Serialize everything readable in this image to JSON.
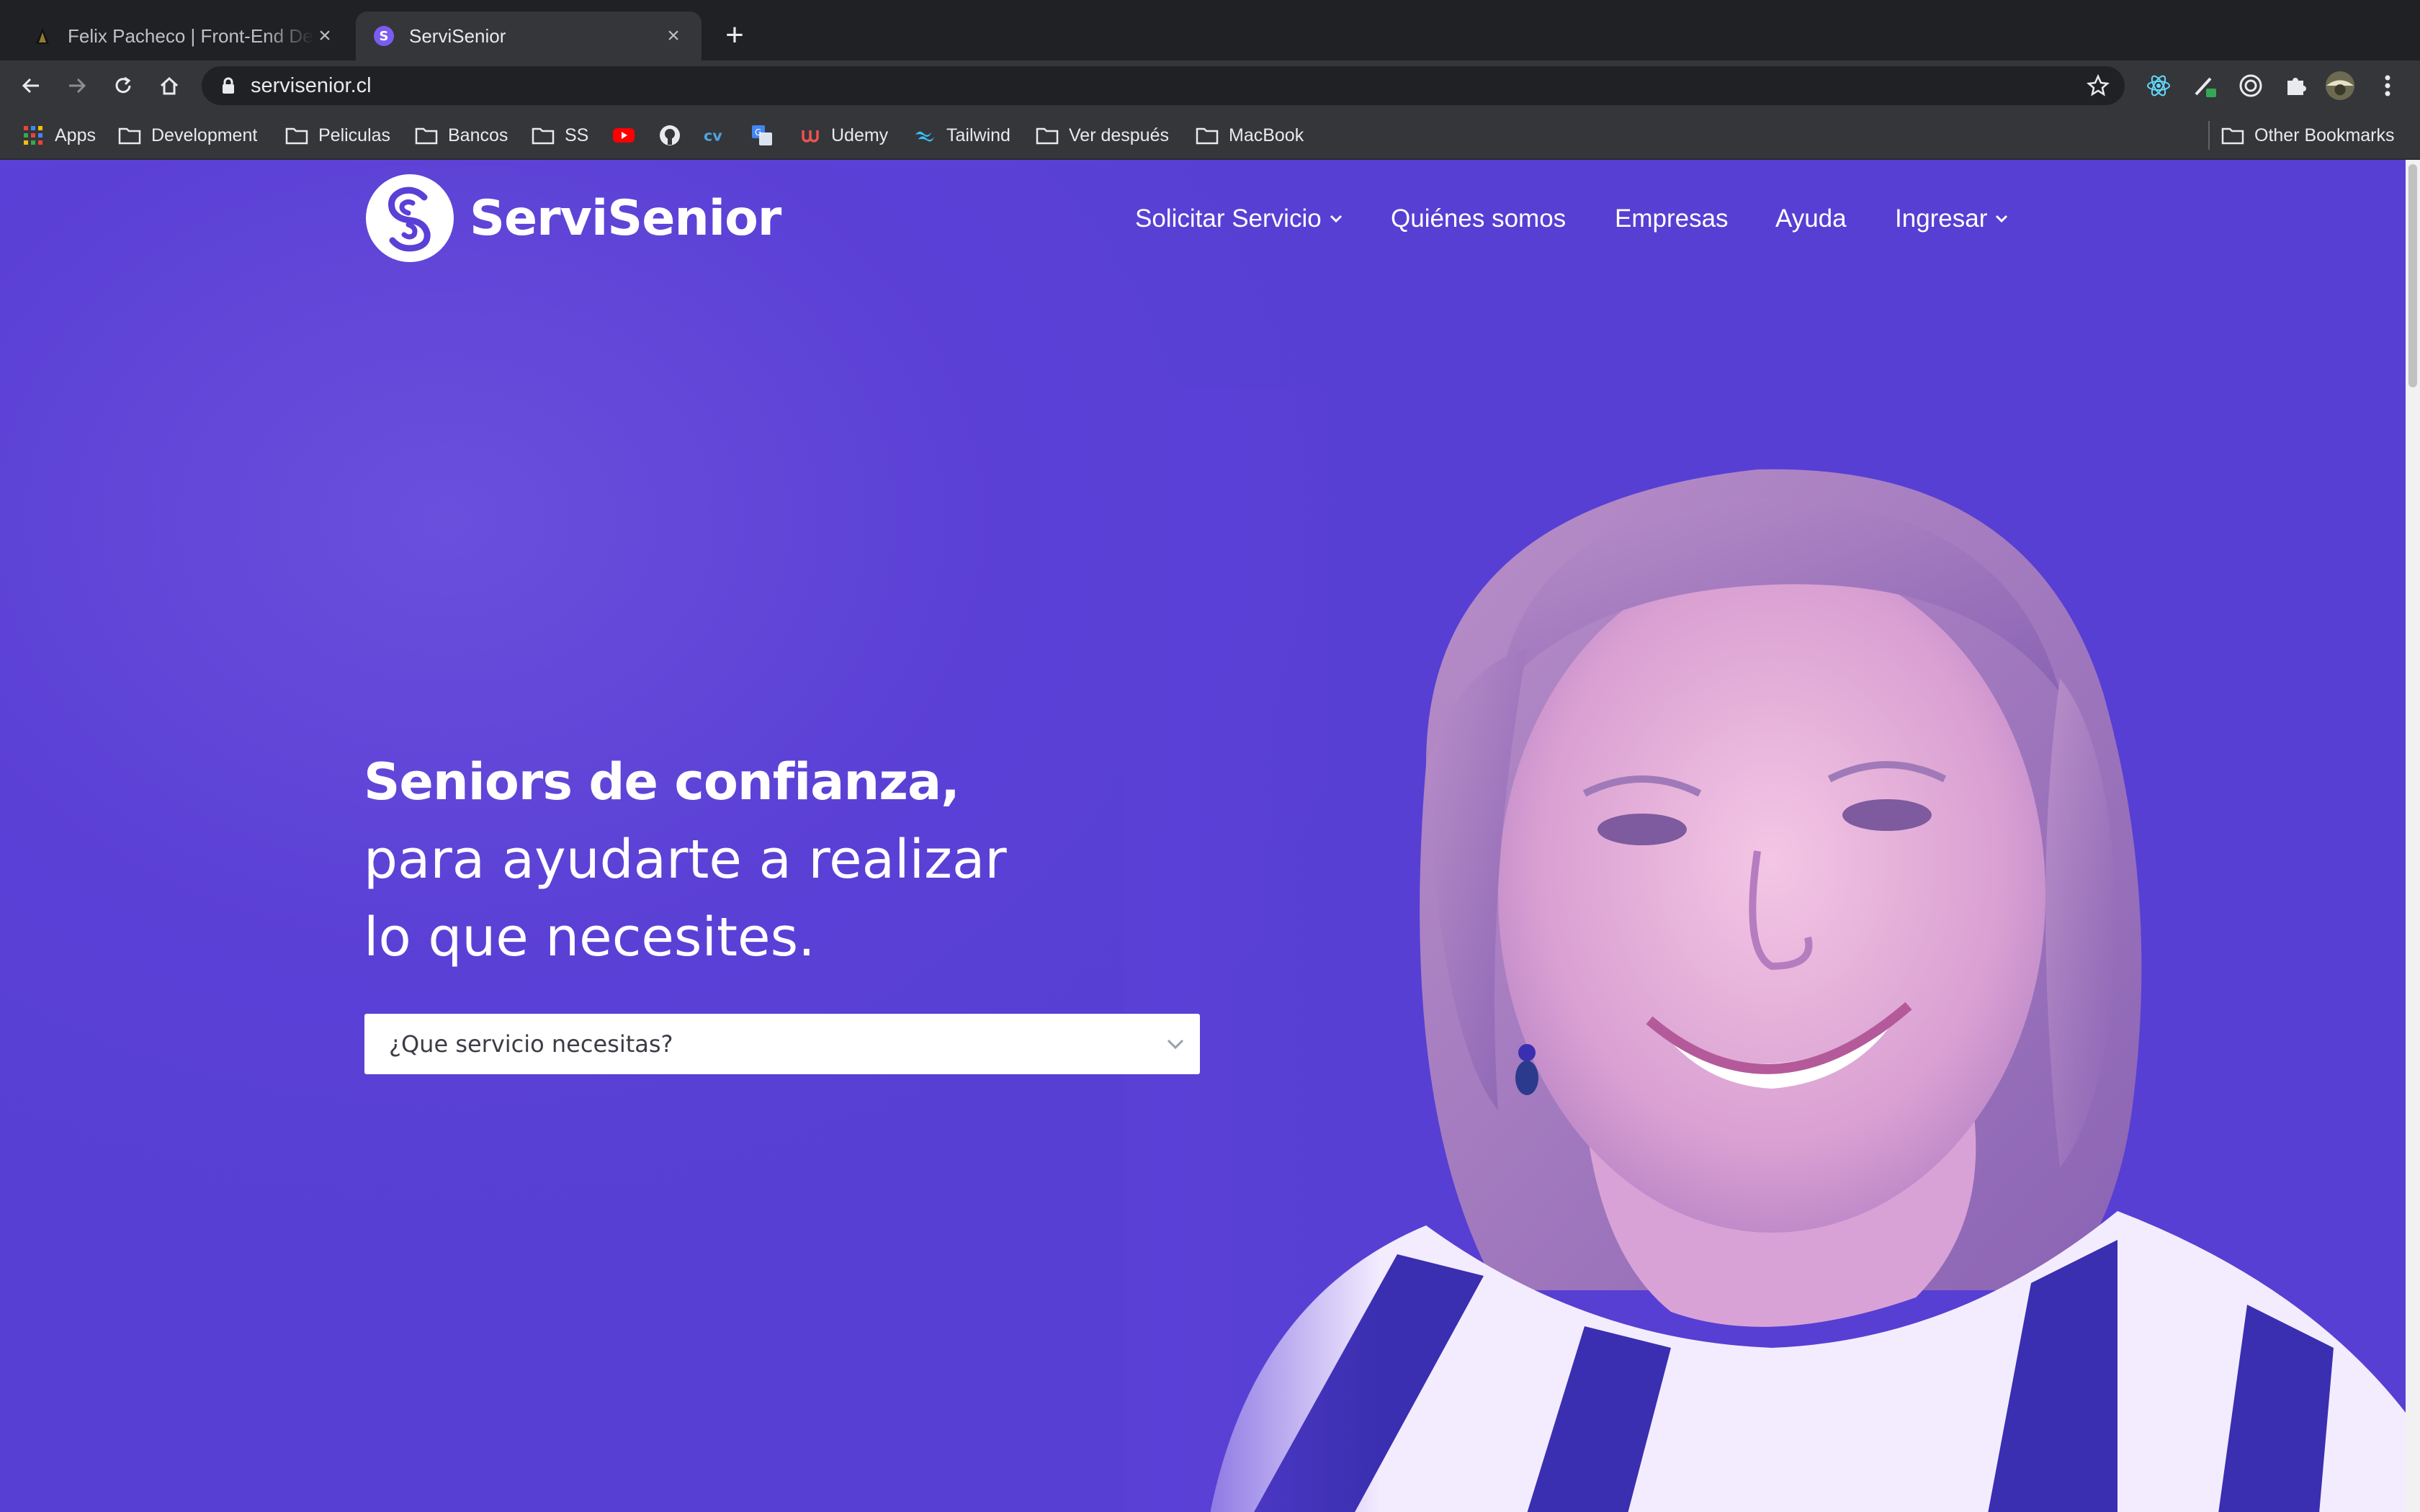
{
  "browser": {
    "tabs": [
      {
        "title": "Felix Pacheco | Front-End Developer",
        "active": false
      },
      {
        "title": "ServiSenior",
        "active": true
      }
    ],
    "url": "servisenior.cl",
    "bookmarks": [
      {
        "label": "Apps",
        "icon": "apps-grid-icon"
      },
      {
        "label": "Development",
        "icon": "folder-icon"
      },
      {
        "label": "Peliculas",
        "icon": "folder-icon"
      },
      {
        "label": "Bancos",
        "icon": "folder-icon"
      },
      {
        "label": "SS",
        "icon": "folder-icon"
      },
      {
        "label": "",
        "icon": "youtube-icon"
      },
      {
        "label": "",
        "icon": "github-icon"
      },
      {
        "label": "",
        "icon": "cv-icon"
      },
      {
        "label": "",
        "icon": "translate-icon"
      },
      {
        "label": "Udemy",
        "icon": "udemy-icon"
      },
      {
        "label": "Tailwind",
        "icon": "tailwind-icon"
      },
      {
        "label": "Ver después",
        "icon": "folder-icon"
      },
      {
        "label": "MacBook",
        "icon": "folder-icon"
      }
    ],
    "other_bookmarks": "Other Bookmarks"
  },
  "site": {
    "logo_text": "ServiSenior",
    "nav": [
      {
        "label": "Solicitar Servicio",
        "dropdown": true
      },
      {
        "label": "Quiénes somos",
        "dropdown": false
      },
      {
        "label": "Empresas",
        "dropdown": false
      },
      {
        "label": "Ayuda",
        "dropdown": false
      },
      {
        "label": "Ingresar",
        "dropdown": true
      }
    ],
    "hero": {
      "line1": "Seniors de confianza,",
      "line2": "para ayudarte a realizar",
      "line3": "lo que necesites.",
      "select_placeholder": "¿Que servicio necesitas?"
    },
    "colors": {
      "brand": "#5b40d6",
      "text": "#ffffff"
    }
  }
}
